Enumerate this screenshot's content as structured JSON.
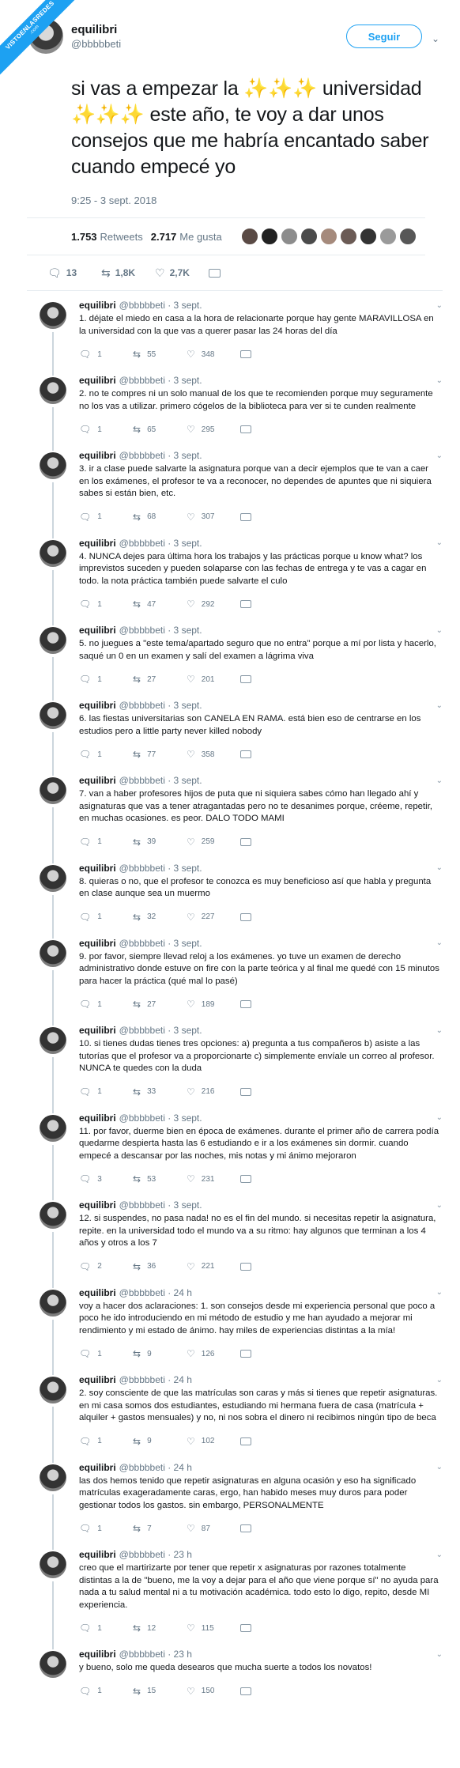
{
  "watermark": {
    "line1": "VISTOENLASREDES",
    "line2": ".com"
  },
  "main_tweet": {
    "name": "equilibri",
    "handle": "@bbbbbeti",
    "follow_label": "Seguir",
    "text": "si vas a empezar la ✨✨✨ universidad ✨✨✨ este año, te voy a dar unos consejos que me habría encantado saber cuando empecé yo",
    "timestamp": "9:25 - 3 sept. 2018",
    "retweets_count": "1.753",
    "retweets_label": "Retweets",
    "likes_count": "2.717",
    "likes_label": "Me gusta",
    "actions": {
      "replies": "13",
      "retweets": "1,8K",
      "likes": "2,7K"
    }
  },
  "icons": {
    "reply": "reply-icon",
    "retweet": "retweet-icon",
    "like": "heart-icon",
    "dm": "mail-icon"
  },
  "colors": {
    "accent": "#1da1f2",
    "muted": "#657786",
    "divider": "#e6ecf0"
  },
  "replies": [
    {
      "name": "equilibri",
      "handle": "@bbbbbeti · 3 sept.",
      "text": "1. déjate el miedo en casa a la hora de relacionarte porque hay gente MARAVILLOSA en la universidad con la que vas a querer pasar las 24 horas del día",
      "c": "1",
      "rt": "55",
      "lk": "348"
    },
    {
      "name": "equilibri",
      "handle": "@bbbbbeti · 3 sept.",
      "text": "2. no te compres ni un solo manual de los que te recomienden porque muy seguramente no los vas a utilizar. primero cógelos de la biblioteca para ver si te cunden realmente",
      "c": "1",
      "rt": "65",
      "lk": "295"
    },
    {
      "name": "equilibri",
      "handle": "@bbbbbeti · 3 sept.",
      "text": "3. ir a clase puede salvarte la asignatura porque van a decir ejemplos que te van a caer en los exámenes, el profesor te va a reconocer, no dependes de apuntes que ni siquiera sabes si están bien, etc.",
      "c": "1",
      "rt": "68",
      "lk": "307"
    },
    {
      "name": "equilibri",
      "handle": "@bbbbbeti · 3 sept.",
      "text": "4. NUNCA dejes para última hora los trabajos y las prácticas porque u know what? los imprevistos suceden y pueden solaparse con las fechas de entrega y te vas a cagar en todo. la nota práctica también puede salvarte el culo",
      "c": "1",
      "rt": "47",
      "lk": "292"
    },
    {
      "name": "equilibri",
      "handle": "@bbbbbeti · 3 sept.",
      "text": "5. no juegues a \"este tema/apartado seguro que no entra\" porque a mí por lista y hacerlo, saqué un 0 en un examen y salí del examen a lágrima viva",
      "c": "1",
      "rt": "27",
      "lk": "201"
    },
    {
      "name": "equilibri",
      "handle": "@bbbbbeti · 3 sept.",
      "text": "6. las fiestas universitarias son CANELA EN RAMA. está bien eso de centrarse en los estudios pero a little party never killed nobody",
      "c": "1",
      "rt": "77",
      "lk": "358"
    },
    {
      "name": "equilibri",
      "handle": "@bbbbbeti · 3 sept.",
      "text": "7. van a haber profesores hijos de puta que ni siquiera sabes cómo han llegado ahí y asignaturas que vas a tener atragantadas pero no te desanimes porque, créeme, repetir, en muchas ocasiones. es peor. DALO TODO MAMI",
      "c": "1",
      "rt": "39",
      "lk": "259"
    },
    {
      "name": "equilibri",
      "handle": "@bbbbbeti · 3 sept.",
      "text": "8. quieras o no, que el profesor te conozca es muy beneficioso así que habla y pregunta en clase aunque sea un muermo",
      "c": "1",
      "rt": "32",
      "lk": "227"
    },
    {
      "name": "equilibri",
      "handle": "@bbbbbeti · 3 sept.",
      "text": "9. por favor, siempre llevad reloj a los exámenes. yo tuve un examen de derecho administrativo donde estuve on fire con la parte teórica y al final me quedé con 15 minutos para hacer la práctica (qué mal lo pasé)",
      "c": "1",
      "rt": "27",
      "lk": "189"
    },
    {
      "name": "equilibri",
      "handle": "@bbbbbeti · 3 sept.",
      "text": "10. si tienes dudas tienes tres opciones: a) pregunta a tus compañeros b) asiste a las tutorías que el profesor va a proporcionarte c) simplemente envíale un correo al profesor. NUNCA te quedes con la duda",
      "c": "1",
      "rt": "33",
      "lk": "216"
    },
    {
      "name": "equilibri",
      "handle": "@bbbbbeti · 3 sept.",
      "text": "11. por favor, duerme bien en época de exámenes. durante el primer año de carrera podía quedarme despierta hasta las 6 estudiando e ir a los exámenes sin dormir. cuando empecé a descansar por las noches, mis notas y mi ánimo mejoraron",
      "c": "3",
      "rt": "53",
      "lk": "231"
    },
    {
      "name": "equilibri",
      "handle": "@bbbbbeti · 3 sept.",
      "text": "12. si suspendes, no pasa nada! no es el fin del mundo. si necesitas repetir la asignatura, repite. en la universidad todo el mundo va a su ritmo: hay algunos que terminan a los 4 años y otros a los 7",
      "c": "2",
      "rt": "36",
      "lk": "221"
    },
    {
      "name": "equilibri",
      "handle": "@bbbbbeti · 24 h",
      "text": "voy a hacer dos aclaraciones: 1. son consejos desde mi experiencia personal que poco a poco he ido introduciendo en mi método de estudio y me han ayudado a mejorar mi rendimiento y mi estado de ánimo. hay miles de experiencias distintas a la mía!",
      "c": "1",
      "rt": "9",
      "lk": "126"
    },
    {
      "name": "equilibri",
      "handle": "@bbbbbeti · 24 h",
      "text": "2. soy consciente de que las matrículas son caras y más si tienes que repetir asignaturas. en mi casa somos dos estudiantes, estudiando mi hermana fuera de casa (matrícula + alquiler + gastos mensuales) y no, ni nos sobra el dinero ni recibimos ningún tipo de beca",
      "c": "1",
      "rt": "9",
      "lk": "102"
    },
    {
      "name": "equilibri",
      "handle": "@bbbbbeti · 24 h",
      "text": "las dos hemos tenido que repetir asignaturas en alguna ocasión y eso ha significado matrículas exageradamente caras, ergo, han habido meses muy duros para poder gestionar todos los gastos. sin embargo, PERSONALMENTE",
      "c": "1",
      "rt": "7",
      "lk": "87"
    },
    {
      "name": "equilibri",
      "handle": "@bbbbbeti · 23 h",
      "text": "creo que el martirizarte por tener que repetir x asignaturas por razones totalmente distintas a la de \"bueno, me la voy a dejar para el año que viene porque sí\" no ayuda para nada a tu salud mental ni a tu motivación académica. todo esto lo digo, repito, desde MI experiencia.",
      "c": "1",
      "rt": "12",
      "lk": "115"
    },
    {
      "name": "equilibri",
      "handle": "@bbbbbeti · 23 h",
      "text": "y bueno, solo me queda desearos que mucha suerte a todos los novatos!",
      "c": "1",
      "rt": "15",
      "lk": "150"
    }
  ]
}
